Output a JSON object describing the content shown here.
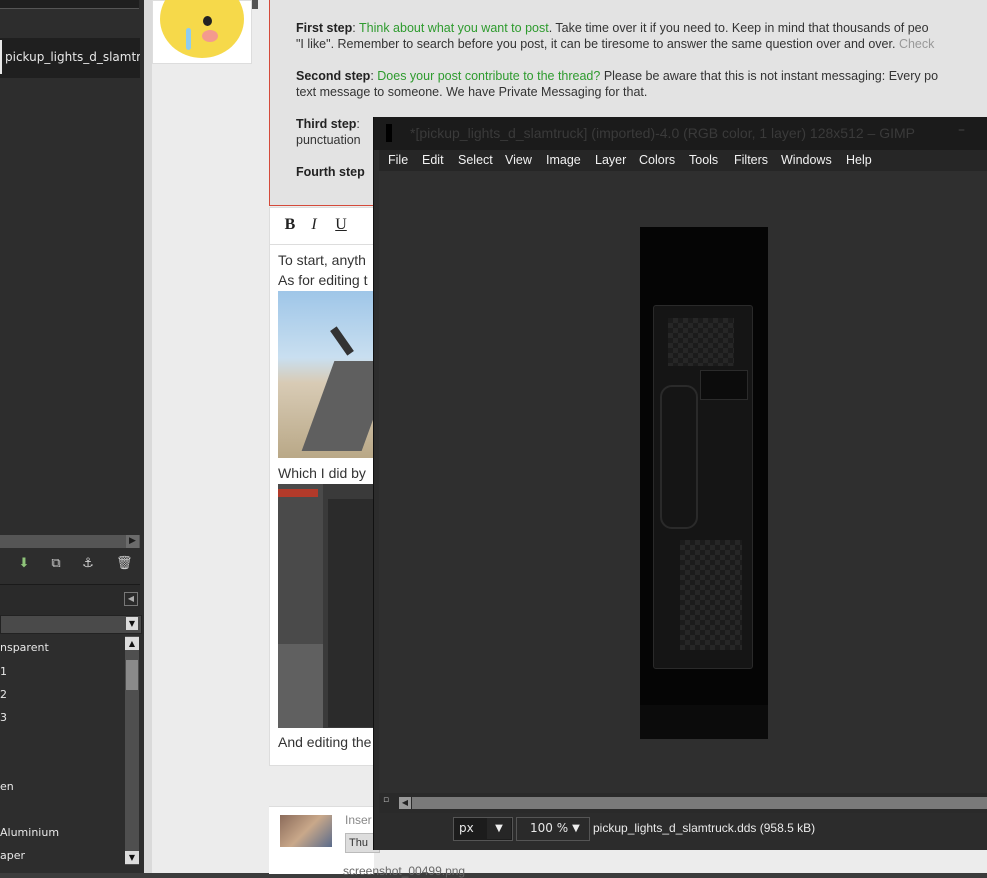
{
  "dock": {
    "layer_name": "pickup_lights_d_slamtruck.d",
    "gradients": [
      "nsparent",
      "1",
      "2",
      "3",
      "en",
      "Aluminium",
      "aper"
    ]
  },
  "rules": {
    "step1_label": "First step",
    "step1_link": "Think about what you want to post",
    "step1_text": ". Take time over it if you need to. Keep in mind that thousands of peo",
    "step1_line2": "\"I like\". Remember to search before you post, it can be tiresome to answer the same question over and over.",
    "step1_check": "Check",
    "step2_label": "Second step",
    "step2_link": "Does your post contribute to the thread?",
    "step2_text": " Please be aware that this is not instant messaging: Every po",
    "step2_line2": "text message to someone. We have Private Messaging for that.",
    "step3_label": "Third step",
    "step3_line2": "punctuation",
    "step4_label": "Fourth step"
  },
  "editor": {
    "bold": "B",
    "italic": "I",
    "underline": "U",
    "line1": "To start, anyth",
    "line2": "As for editing t",
    "line3": "Which I did by",
    "line4": "And editing the"
  },
  "attachments": {
    "insert_label": "Inser",
    "thumb_button": "Thu",
    "file_name": "screenshot_00499.png"
  },
  "gimp": {
    "title": "*[pickup_lights_d_slamtruck] (imported)-4.0 (RGB color, 1 layer) 128x512 – GIMP",
    "min_button": "–",
    "menu": [
      "File",
      "Edit",
      "Select",
      "View",
      "Image",
      "Layer",
      "Colors",
      "Tools",
      "Filters",
      "Windows",
      "Help"
    ],
    "unit": "px",
    "zoom": "100 %",
    "status_file": "pickup_lights_d_slamtruck.dds (958.5 kB)"
  },
  "colors": {
    "accent_green": "#2e9b2e",
    "rules_border": "#d44a3a",
    "gimp_dark": "#2c2c2c"
  }
}
